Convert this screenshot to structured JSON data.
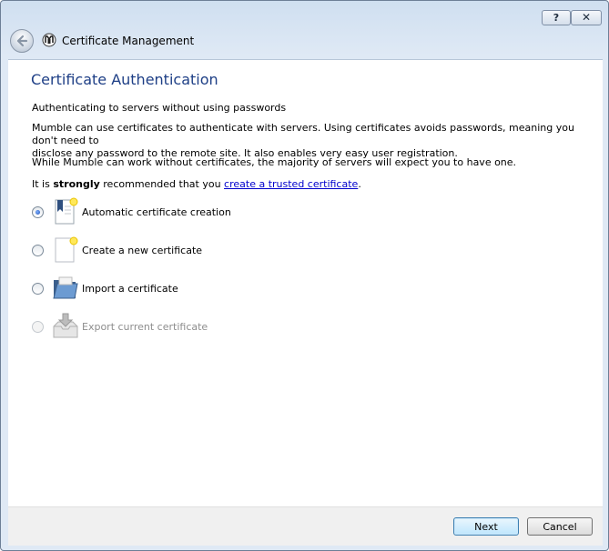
{
  "window": {
    "title": "Certificate Management",
    "help_label": "?",
    "close_label": "✕"
  },
  "page": {
    "heading": "Certificate Authentication",
    "subtitle": "Authenticating to servers without using passwords",
    "intro_line1": "Mumble can use certificates to authenticate with servers. Using certificates avoids passwords, meaning you don't need to",
    "intro_line2": "disclose any password to the remote site. It also enables very easy user registration.",
    "while_text": "While Mumble can work without certificates, the majority of servers will expect you to have one.",
    "recommend_prefix": "It is ",
    "recommend_strong": "strongly",
    "recommend_middle": " recommended that you ",
    "recommend_link": "create a trusted certificate",
    "recommend_suffix": "."
  },
  "options": [
    {
      "label": "Automatic certificate creation",
      "checked": true,
      "enabled": true,
      "icon": "auto-certificate-icon"
    },
    {
      "label": "Create a new certificate",
      "checked": false,
      "enabled": true,
      "icon": "new-document-icon"
    },
    {
      "label": "Import a certificate",
      "checked": false,
      "enabled": true,
      "icon": "folder-icon"
    },
    {
      "label": "Export current certificate",
      "checked": false,
      "enabled": false,
      "icon": "export-icon"
    }
  ],
  "footer": {
    "next_label": "Next",
    "cancel_label": "Cancel"
  }
}
